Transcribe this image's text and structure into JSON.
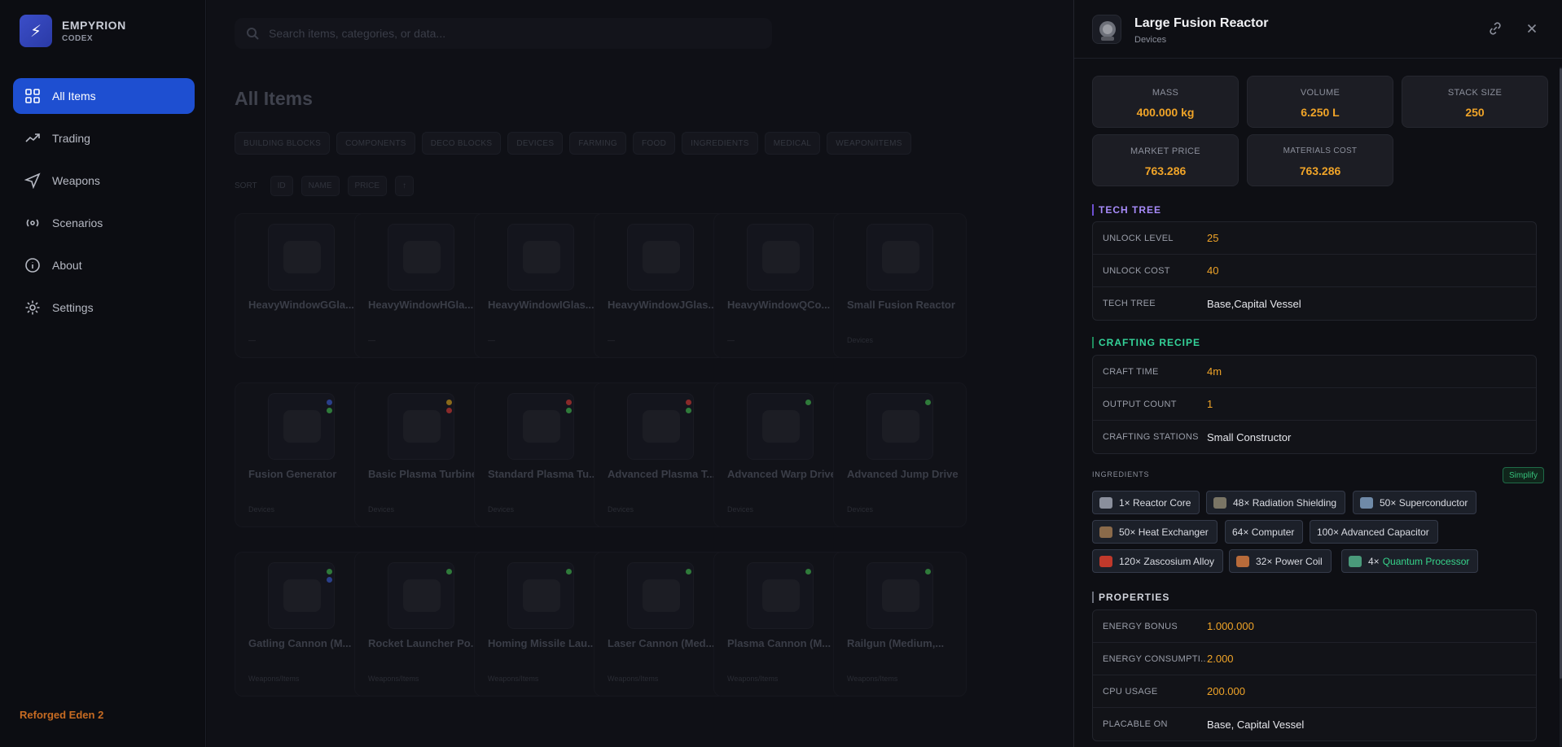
{
  "brand": {
    "name": "EMPYRION",
    "sub": "CODEX",
    "version": "Reforged Eden 2"
  },
  "nav": [
    {
      "label": "All Items",
      "icon": "grid-icon",
      "active": true
    },
    {
      "label": "Trading",
      "icon": "trend-icon"
    },
    {
      "label": "Weapons",
      "icon": "send-icon"
    },
    {
      "label": "Scenarios",
      "icon": "broadcast-icon"
    },
    {
      "label": "About",
      "icon": "info-icon"
    },
    {
      "label": "Settings",
      "icon": "gear-icon"
    }
  ],
  "main": {
    "search_placeholder": "Search items, categories, or data...",
    "title": "All Items",
    "categories": [
      "BUILDING BLOCKS",
      "COMPONENTS",
      "DECO BLOCKS",
      "DEVICES",
      "FARMING",
      "FOOD",
      "INGREDIENTS",
      "MEDICAL",
      "WEAPON/ITEMS"
    ],
    "sort_label": "SORT",
    "sort_buttons": [
      "ID",
      "NAME",
      "PRICE",
      "↑"
    ],
    "cards": [
      {
        "name": "HeavyWindowGGla...",
        "cat": "—"
      },
      {
        "name": "HeavyWindowHGla...",
        "cat": "—"
      },
      {
        "name": "HeavyWindowIGlas...",
        "cat": "—"
      },
      {
        "name": "HeavyWindowJGlas...",
        "cat": "—"
      },
      {
        "name": "HeavyWindowQCo...",
        "cat": "—"
      },
      {
        "name": "Small Fusion Reactor",
        "cat": "Devices"
      },
      {
        "name": "Fusion Generator",
        "cat": "Devices"
      },
      {
        "name": "Basic Plasma Turbine",
        "cat": "Devices"
      },
      {
        "name": "Standard Plasma Tu...",
        "cat": "Devices"
      },
      {
        "name": "Advanced Plasma T...",
        "cat": "Devices"
      },
      {
        "name": "Advanced Warp Drive",
        "cat": "Devices"
      },
      {
        "name": "Advanced Jump Drive",
        "cat": "Devices"
      },
      {
        "name": "Gatling Cannon (M...",
        "cat": "Weapons/Items"
      },
      {
        "name": "Rocket Launcher Po...",
        "cat": "Weapons/Items"
      },
      {
        "name": "Homing Missile Lau...",
        "cat": "Weapons/Items"
      },
      {
        "name": "Laser Cannon (Med...",
        "cat": "Weapons/Items"
      },
      {
        "name": "Plasma Cannon (M...",
        "cat": "Weapons/Items"
      },
      {
        "name": "Railgun (Medium,...",
        "cat": "Weapons/Items"
      }
    ]
  },
  "detail": {
    "title": "Large Fusion Reactor",
    "category": "Devices",
    "stats": [
      {
        "label": "MASS",
        "value": "400.000 kg"
      },
      {
        "label": "VOLUME",
        "value": "6.250 L"
      },
      {
        "label": "STACK SIZE",
        "value": "250"
      },
      {
        "label": "MARKET PRICE",
        "value": "763.286"
      },
      {
        "label": "MATERIALS COST",
        "value": "763.286"
      }
    ],
    "tech_tree": {
      "title": "TECH TREE",
      "color": "#a78bfa",
      "rows": [
        {
          "key": "UNLOCK LEVEL",
          "value": "25",
          "num": true
        },
        {
          "key": "UNLOCK COST",
          "value": "40",
          "num": true
        },
        {
          "key": "TECH TREE",
          "value": "Base,Capital Vessel",
          "num": false
        }
      ]
    },
    "crafting": {
      "title": "CRAFTING RECIPE",
      "color": "#34d399",
      "rows": [
        {
          "key": "CRAFT TIME",
          "value": "4m",
          "num": true
        },
        {
          "key": "OUTPUT COUNT",
          "value": "1",
          "num": true
        },
        {
          "key": "CRAFTING STATIONS",
          "value": "Small Constructor",
          "num": false
        }
      ]
    },
    "ingredients_label": "INGREDIENTS",
    "simplify_label": "Simplify",
    "ingredients": [
      {
        "label": "1× Reactor Core",
        "icon_color": "#8a8f9c"
      },
      {
        "label": "48× Radiation Shielding",
        "icon_color": "#7a7565"
      },
      {
        "label": "50× Superconductor",
        "icon_color": "#6f8aa8"
      },
      {
        "label": "50× Heat Exchanger",
        "icon_color": "#8a6a4a"
      },
      {
        "label": "64× Computer",
        "icon_color": ""
      },
      {
        "label": "100× Advanced Capacitor",
        "icon_color": ""
      },
      {
        "label": "120× Zascosium Alloy",
        "icon_color": "#c0392b"
      },
      {
        "label": "32× Power Coil",
        "icon_color": "#b86b3a"
      },
      {
        "label": "4×",
        "highlight": "Quantum Processor",
        "icon_color": "#4a9a7a"
      }
    ],
    "properties": {
      "title": "PROPERTIES",
      "color": "#cfd2da",
      "rows": [
        {
          "key": "ENERGY BONUS",
          "value": "1.000.000",
          "num": true
        },
        {
          "key": "ENERGY CONSUMPTI...",
          "value": "2.000",
          "num": true
        },
        {
          "key": "CPU USAGE",
          "value": "200.000",
          "num": true
        },
        {
          "key": "PLACABLE ON",
          "value": "Base, Capital Vessel",
          "num": false
        }
      ]
    }
  }
}
